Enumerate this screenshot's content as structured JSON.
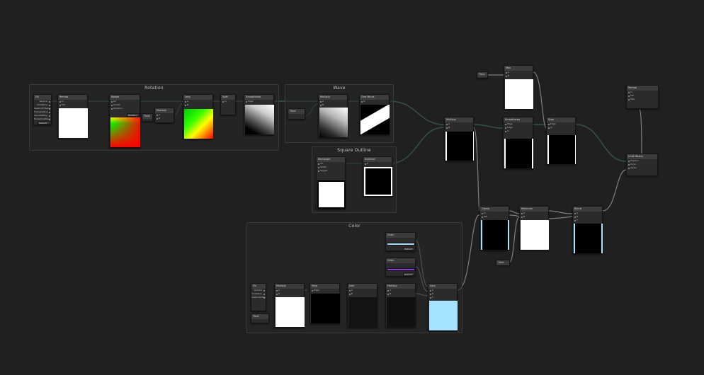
{
  "groups": {
    "rotation": "Rotation",
    "wave": "Wave",
    "square_outline": "Square Outline",
    "color": "Color"
  },
  "nodes": {
    "uv": "UV",
    "uv_ports": [
      "Vector2",
      "SineWave",
      "SawtoothWave",
      "TriangleWave",
      "SquareWave",
      "NoiseSineWave"
    ],
    "remap": "Remap",
    "rotate": "Rotate",
    "rotate_ports": [
      "UV",
      "Center",
      "Rotation"
    ],
    "rotate_unit": "Radians",
    "multiply": "Multiply",
    "split": "Split",
    "lerp": "Lerp",
    "smoothstep": "Smoothstep",
    "step": "Step",
    "rectangle": "Rectangle",
    "subtract": "Subtract",
    "one_minus": "One Minus",
    "add": "Add",
    "clamp": "Clamp",
    "max": "Max",
    "minimum": "Minimum",
    "blend": "Blend",
    "master": "Unlit Master",
    "master_ports": [
      "Position",
      "Color",
      "Alpha"
    ],
    "time": "Time",
    "color_a": "Color",
    "color_b": "Color",
    "ports_in": "In",
    "ports_out": "Out",
    "port_a": "A",
    "port_b": "B",
    "port_t": "T",
    "port_edge": "Edge",
    "port_width": "Width",
    "port_height": "Height",
    "port_min": "Min",
    "port_max": "Max",
    "hdr": "Default"
  },
  "colors": {
    "background": "#202020",
    "wire": "#33544c",
    "wire_gray": "#7e7e7e",
    "preview_cyan": "#a6e3ff",
    "swatch_blue": "#a8dcff",
    "swatch_purple": "#8d3fd8"
  }
}
